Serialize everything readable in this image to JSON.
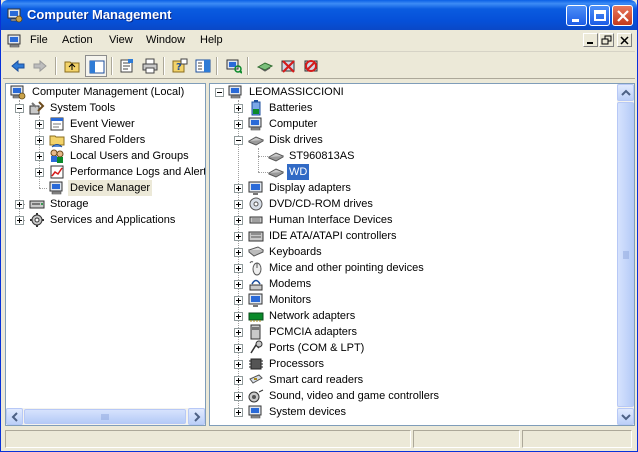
{
  "window": {
    "title": "Computer Management",
    "colors": {
      "titlebar": "#0a5ce0",
      "selection": "#316ac5",
      "chrome": "#ece9d8"
    }
  },
  "menu": [
    "File",
    "Action",
    "View",
    "Window",
    "Help"
  ],
  "left_tree": {
    "root": "Computer Management (Local)",
    "system_tools": "System Tools",
    "children": [
      "Event Viewer",
      "Shared Folders",
      "Local Users and Groups",
      "Performance Logs and Alerts",
      "Device Manager"
    ],
    "storage": "Storage",
    "services": "Services and Applications"
  },
  "right_tree": {
    "root": "LEOMASSICCIONI",
    "batteries": "Batteries",
    "computer": "Computer",
    "disk_drives": "Disk drives",
    "disk_children": [
      "ST960813AS",
      "WD"
    ],
    "categories": [
      "Display adapters",
      "DVD/CD-ROM drives",
      "Human Interface Devices",
      "IDE ATA/ATAPI controllers",
      "Keyboards",
      "Mice and other pointing devices",
      "Modems",
      "Monitors",
      "Network adapters",
      "PCMCIA adapters",
      "Ports (COM & LPT)",
      "Processors",
      "Smart card readers",
      "Sound, video and game controllers",
      "System devices"
    ]
  }
}
